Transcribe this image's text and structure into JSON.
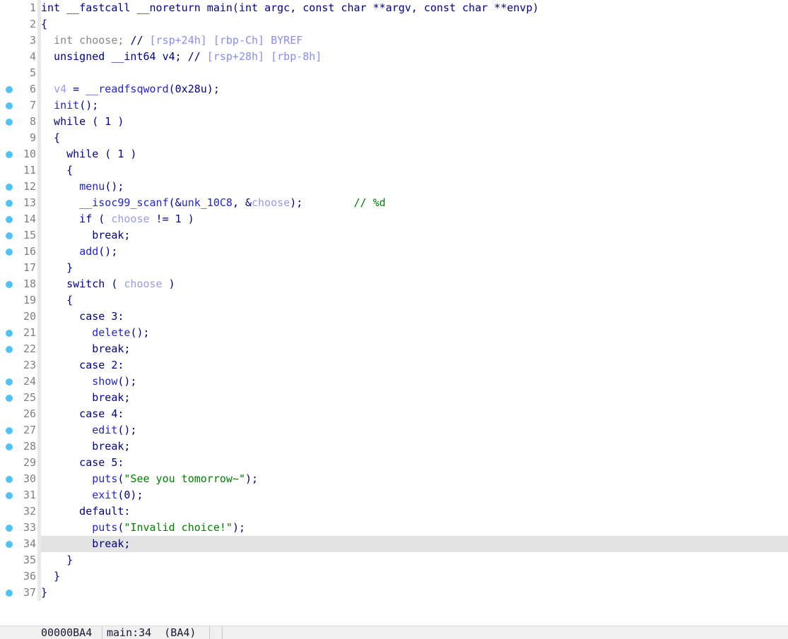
{
  "view": {
    "kind": "ida-pseudocode",
    "background": "#ffffff",
    "cursor_line": 34,
    "total_lines": 37,
    "colors": {
      "line_number": "#808080",
      "gutter_dot": "#4fc3f7",
      "gutter_separator": "#e9e9e9",
      "cursor_line_highlight": "#e3e3e3",
      "keyword": "#00008b",
      "function": "#2222dd",
      "string": "#008000",
      "comment": "#008000",
      "stack_comment": "#8b8bf0",
      "variable": "#9999ee",
      "dim_declaration": "#888888",
      "status_bar_bg": "#f0f0f0"
    }
  },
  "lines": [
    {
      "n": 1,
      "dot": false,
      "tokens": [
        {
          "t": "int __fastcall __noreturn main(int argc, const char **argv, const char **envp)",
          "c": "t-kw"
        }
      ]
    },
    {
      "n": 2,
      "dot": false,
      "tokens": [
        {
          "t": "{",
          "c": "t-kw"
        }
      ]
    },
    {
      "n": 3,
      "dot": false,
      "tokens": [
        {
          "t": "  int choose; ",
          "c": "t-gray"
        },
        {
          "t": "//",
          "c": "t-kw"
        },
        {
          "t": " [rsp+24h] [rbp-Ch] BYREF",
          "c": "t-stkcmt"
        }
      ]
    },
    {
      "n": 4,
      "dot": false,
      "tokens": [
        {
          "t": "  unsigned __int64 v4; ",
          "c": "t-kw"
        },
        {
          "t": "//",
          "c": "t-kw"
        },
        {
          "t": " [rsp+28h] [rbp-8h]",
          "c": "t-stkcmt"
        }
      ]
    },
    {
      "n": 5,
      "dot": false,
      "tokens": [
        {
          "t": "",
          "c": "t-plain"
        }
      ]
    },
    {
      "n": 6,
      "dot": true,
      "tokens": [
        {
          "t": "  ",
          "c": "t-plain"
        },
        {
          "t": "v4",
          "c": "t-var"
        },
        {
          "t": " = ",
          "c": "t-kw"
        },
        {
          "t": "__readfsqword",
          "c": "t-fn"
        },
        {
          "t": "(0x28u);",
          "c": "t-kw"
        }
      ]
    },
    {
      "n": 7,
      "dot": true,
      "tokens": [
        {
          "t": "  ",
          "c": "t-plain"
        },
        {
          "t": "init",
          "c": "t-fn"
        },
        {
          "t": "();",
          "c": "t-kw"
        }
      ]
    },
    {
      "n": 8,
      "dot": true,
      "tokens": [
        {
          "t": "  while ( 1 )",
          "c": "t-kw"
        }
      ]
    },
    {
      "n": 9,
      "dot": false,
      "tokens": [
        {
          "t": "  {",
          "c": "t-kw"
        }
      ]
    },
    {
      "n": 10,
      "dot": true,
      "tokens": [
        {
          "t": "    while ( 1 )",
          "c": "t-kw"
        }
      ]
    },
    {
      "n": 11,
      "dot": false,
      "tokens": [
        {
          "t": "    {",
          "c": "t-kw"
        }
      ]
    },
    {
      "n": 12,
      "dot": true,
      "tokens": [
        {
          "t": "      ",
          "c": "t-plain"
        },
        {
          "t": "menu",
          "c": "t-fn"
        },
        {
          "t": "();",
          "c": "t-kw"
        }
      ]
    },
    {
      "n": 13,
      "dot": true,
      "tokens": [
        {
          "t": "      ",
          "c": "t-plain"
        },
        {
          "t": "__isoc99_scanf",
          "c": "t-fn"
        },
        {
          "t": "(&",
          "c": "t-kw"
        },
        {
          "t": "unk_10C8",
          "c": "t-fn"
        },
        {
          "t": ", &",
          "c": "t-kw"
        },
        {
          "t": "choose",
          "c": "t-var"
        },
        {
          "t": ");        ",
          "c": "t-kw"
        },
        {
          "t": "// %d",
          "c": "t-cmt"
        }
      ]
    },
    {
      "n": 14,
      "dot": true,
      "tokens": [
        {
          "t": "      if ( ",
          "c": "t-kw"
        },
        {
          "t": "choose",
          "c": "t-var"
        },
        {
          "t": " != 1 )",
          "c": "t-kw"
        }
      ]
    },
    {
      "n": 15,
      "dot": true,
      "tokens": [
        {
          "t": "        break;",
          "c": "t-kw"
        }
      ]
    },
    {
      "n": 16,
      "dot": true,
      "tokens": [
        {
          "t": "      ",
          "c": "t-plain"
        },
        {
          "t": "add",
          "c": "t-fn"
        },
        {
          "t": "();",
          "c": "t-kw"
        }
      ]
    },
    {
      "n": 17,
      "dot": false,
      "tokens": [
        {
          "t": "    }",
          "c": "t-kw"
        }
      ]
    },
    {
      "n": 18,
      "dot": true,
      "tokens": [
        {
          "t": "    switch ( ",
          "c": "t-kw"
        },
        {
          "t": "choose",
          "c": "t-var"
        },
        {
          "t": " )",
          "c": "t-kw"
        }
      ]
    },
    {
      "n": 19,
      "dot": false,
      "tokens": [
        {
          "t": "    {",
          "c": "t-kw"
        }
      ]
    },
    {
      "n": 20,
      "dot": false,
      "tokens": [
        {
          "t": "      case 3:",
          "c": "t-kw"
        }
      ]
    },
    {
      "n": 21,
      "dot": true,
      "tokens": [
        {
          "t": "        ",
          "c": "t-plain"
        },
        {
          "t": "delete",
          "c": "t-fn"
        },
        {
          "t": "();",
          "c": "t-kw"
        }
      ]
    },
    {
      "n": 22,
      "dot": true,
      "tokens": [
        {
          "t": "        break;",
          "c": "t-kw"
        }
      ]
    },
    {
      "n": 23,
      "dot": false,
      "tokens": [
        {
          "t": "      case 2:",
          "c": "t-kw"
        }
      ]
    },
    {
      "n": 24,
      "dot": true,
      "tokens": [
        {
          "t": "        ",
          "c": "t-plain"
        },
        {
          "t": "show",
          "c": "t-fn"
        },
        {
          "t": "();",
          "c": "t-kw"
        }
      ]
    },
    {
      "n": 25,
      "dot": true,
      "tokens": [
        {
          "t": "        break;",
          "c": "t-kw"
        }
      ]
    },
    {
      "n": 26,
      "dot": false,
      "tokens": [
        {
          "t": "      case 4:",
          "c": "t-kw"
        }
      ]
    },
    {
      "n": 27,
      "dot": true,
      "tokens": [
        {
          "t": "        ",
          "c": "t-plain"
        },
        {
          "t": "edit",
          "c": "t-fn"
        },
        {
          "t": "();",
          "c": "t-kw"
        }
      ]
    },
    {
      "n": 28,
      "dot": true,
      "tokens": [
        {
          "t": "        break;",
          "c": "t-kw"
        }
      ]
    },
    {
      "n": 29,
      "dot": false,
      "tokens": [
        {
          "t": "      case 5:",
          "c": "t-kw"
        }
      ]
    },
    {
      "n": 30,
      "dot": true,
      "tokens": [
        {
          "t": "        ",
          "c": "t-plain"
        },
        {
          "t": "puts",
          "c": "t-fn"
        },
        {
          "t": "(",
          "c": "t-kw"
        },
        {
          "t": "\"See you tomorrow~\"",
          "c": "t-str"
        },
        {
          "t": ");",
          "c": "t-kw"
        }
      ]
    },
    {
      "n": 31,
      "dot": true,
      "tokens": [
        {
          "t": "        ",
          "c": "t-plain"
        },
        {
          "t": "exit",
          "c": "t-fn"
        },
        {
          "t": "(0);",
          "c": "t-kw"
        }
      ]
    },
    {
      "n": 32,
      "dot": false,
      "tokens": [
        {
          "t": "      default:",
          "c": "t-kw"
        }
      ]
    },
    {
      "n": 33,
      "dot": true,
      "tokens": [
        {
          "t": "        ",
          "c": "t-plain"
        },
        {
          "t": "puts",
          "c": "t-fn"
        },
        {
          "t": "(",
          "c": "t-kw"
        },
        {
          "t": "\"Invalid choice!\"",
          "c": "t-str"
        },
        {
          "t": ");",
          "c": "t-kw"
        }
      ]
    },
    {
      "n": 34,
      "dot": true,
      "tokens": [
        {
          "t": "        break;",
          "c": "t-kw"
        }
      ]
    },
    {
      "n": 35,
      "dot": false,
      "tokens": [
        {
          "t": "    }",
          "c": "t-kw"
        }
      ]
    },
    {
      "n": 36,
      "dot": false,
      "tokens": [
        {
          "t": "  }",
          "c": "t-kw"
        }
      ]
    },
    {
      "n": 37,
      "dot": true,
      "tokens": [
        {
          "t": "}",
          "c": "t-kw"
        }
      ]
    }
  ],
  "status_bar": {
    "address": "00000BA4",
    "location": "main:34  (BA4)",
    "cell3": "",
    "cell4": ""
  }
}
